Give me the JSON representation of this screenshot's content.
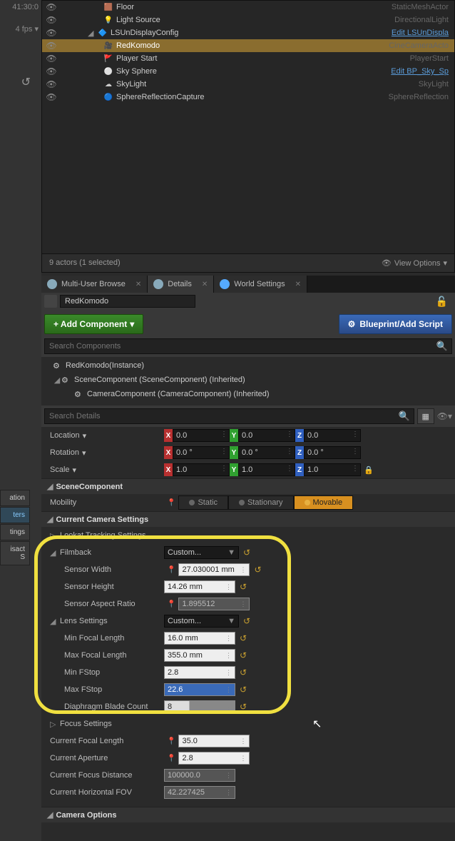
{
  "left": {
    "time": "41:30:0",
    "fps": "4 fps ▾",
    "tags": [
      "ation",
      "ters",
      "tings",
      "isact S"
    ]
  },
  "outliner": {
    "rows": [
      {
        "indent": 60,
        "icon": "🟫",
        "name": "Floor",
        "type": "StaticMeshActor",
        "link": false
      },
      {
        "indent": 60,
        "icon": "💡",
        "name": "Light Source",
        "type": "DirectionalLight",
        "link": false
      },
      {
        "indent": 42,
        "icon": "🔷",
        "name": "LSUnDisplayConfig",
        "type": "Edit LSUnDispla",
        "link": true,
        "expanded": true
      },
      {
        "indent": 60,
        "icon": "🎥",
        "name": "RedKomodo",
        "type": "CineCameraActo",
        "link": false,
        "selected": true
      },
      {
        "indent": 60,
        "icon": "🚩",
        "name": "Player Start",
        "type": "PlayerStart",
        "link": false
      },
      {
        "indent": 60,
        "icon": "⚪",
        "name": "Sky Sphere",
        "type": "Edit BP_Sky_Sp",
        "link": true
      },
      {
        "indent": 60,
        "icon": "☁",
        "name": "SkyLight",
        "type": "SkyLight",
        "link": false
      },
      {
        "indent": 60,
        "icon": "🔵",
        "name": "SphereReflectionCapture",
        "type": "SphereReflection",
        "link": false
      }
    ],
    "footer": "9 actors (1 selected)",
    "view_opts": "View Options"
  },
  "tabs": [
    {
      "icon": "#8ab",
      "label": "Multi-User Browse"
    },
    {
      "icon": "#8ab",
      "label": "Details",
      "active": true
    },
    {
      "icon": "#5af",
      "label": "World Settings"
    }
  ],
  "crumb": "RedKomodo",
  "buttons": {
    "add": "+ Add Component",
    "bp": "Blueprint/Add Script"
  },
  "search_components": "Search Components",
  "components": [
    {
      "indent": 0,
      "name": "RedKomodo(Instance)"
    },
    {
      "indent": 12,
      "name": "SceneComponent (SceneComponent) (Inherited)",
      "exp": "◢"
    },
    {
      "indent": 30,
      "name": "CameraComponent (CameraComponent) (Inherited)"
    }
  ],
  "search_details": "Search Details",
  "transform": {
    "location": {
      "label": "Location",
      "x": "0.0",
      "y": "0.0",
      "z": "0.0"
    },
    "rotation": {
      "label": "Rotation",
      "x": "0.0 °",
      "y": "0.0 °",
      "z": "0.0 °"
    },
    "scale": {
      "label": "Scale",
      "x": "1.0",
      "y": "1.0",
      "z": "1.0"
    }
  },
  "scene_comp": {
    "header": "SceneComponent",
    "mobility": "Mobility",
    "static": "Static",
    "stationary": "Stationary",
    "movable": "Movable"
  },
  "camera": {
    "header": "Current Camera Settings",
    "lookat": "Lookat Tracking Settings",
    "filmback": {
      "label": "Filmback",
      "value": "Custom..."
    },
    "sensor_w": {
      "label": "Sensor Width",
      "value": "27.030001 mm"
    },
    "sensor_h": {
      "label": "Sensor Height",
      "value": "14.26 mm"
    },
    "aspect": {
      "label": "Sensor Aspect Ratio",
      "value": "1.895512"
    },
    "lens": {
      "label": "Lens Settings",
      "value": "Custom..."
    },
    "min_fl": {
      "label": "Min Focal Length",
      "value": "16.0 mm"
    },
    "max_fl": {
      "label": "Max Focal Length",
      "value": "355.0 mm"
    },
    "min_fs": {
      "label": "Min FStop",
      "value": "2.8"
    },
    "max_fs": {
      "label": "Max FStop",
      "value": "22.6"
    },
    "blade": {
      "label": "Diaphragm Blade Count",
      "value": "8"
    },
    "focus": "Focus Settings",
    "cur_fl": {
      "label": "Current Focal Length",
      "value": "35.0"
    },
    "cur_ap": {
      "label": "Current Aperture",
      "value": "2.8"
    },
    "cur_fd": {
      "label": "Current Focus Distance",
      "value": "100000.0"
    },
    "cur_fov": {
      "label": "Current Horizontal FOV",
      "value": "42.227425"
    },
    "cam_opts": "Camera Options"
  }
}
